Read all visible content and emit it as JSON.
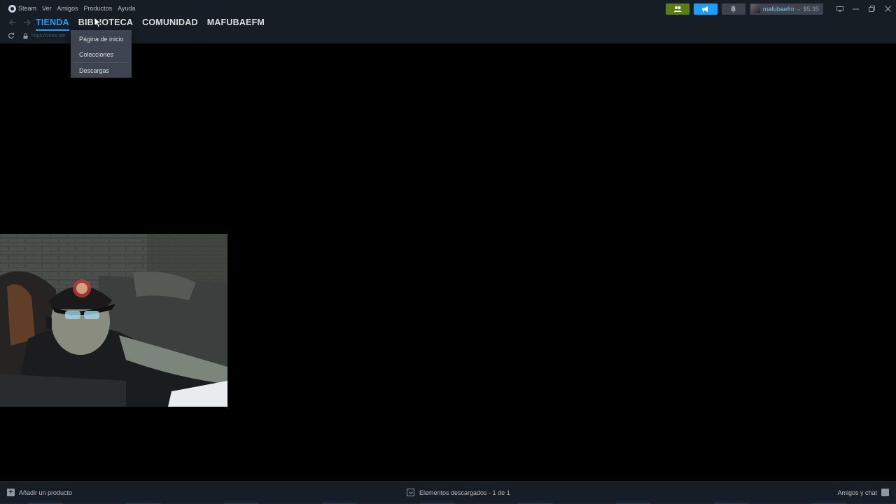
{
  "menubar": {
    "steam_label": "Steam",
    "items": [
      "Ver",
      "Amigos",
      "Productos",
      "Ayuda"
    ]
  },
  "topright": {
    "username": "mafubaefm",
    "wallet": "$5.35"
  },
  "nav": {
    "tabs": [
      {
        "label": "TIENDA",
        "active": true
      },
      {
        "label": "BIBLIOTECA",
        "active": false
      },
      {
        "label": "COMUNIDAD",
        "active": false
      },
      {
        "label": "MAFUBAEFM",
        "active": false
      }
    ]
  },
  "url": {
    "text": "https://store.ste"
  },
  "dropdown": {
    "items": [
      "Página de inicio",
      "Colecciones",
      "Descargas"
    ]
  },
  "footer": {
    "add_product": "Añadir un producto",
    "downloads": "Elementos descargados - 1 de 1",
    "friends_chat": "Amigos y chat"
  },
  "colors": {
    "chrome_bg": "#171d25",
    "accent_blue": "#1a9fff",
    "friends_green": "#5c7e10"
  },
  "icons": {
    "steam": "steam-logo-icon",
    "friends": "friends-icon",
    "announce": "megaphone-icon",
    "bell": "bell-icon",
    "back": "arrow-left-icon",
    "forward": "arrow-right-icon",
    "reload": "reload-icon",
    "lock": "lock-icon",
    "add": "plus-icon",
    "download": "download-icon",
    "chat": "chat-icon"
  }
}
